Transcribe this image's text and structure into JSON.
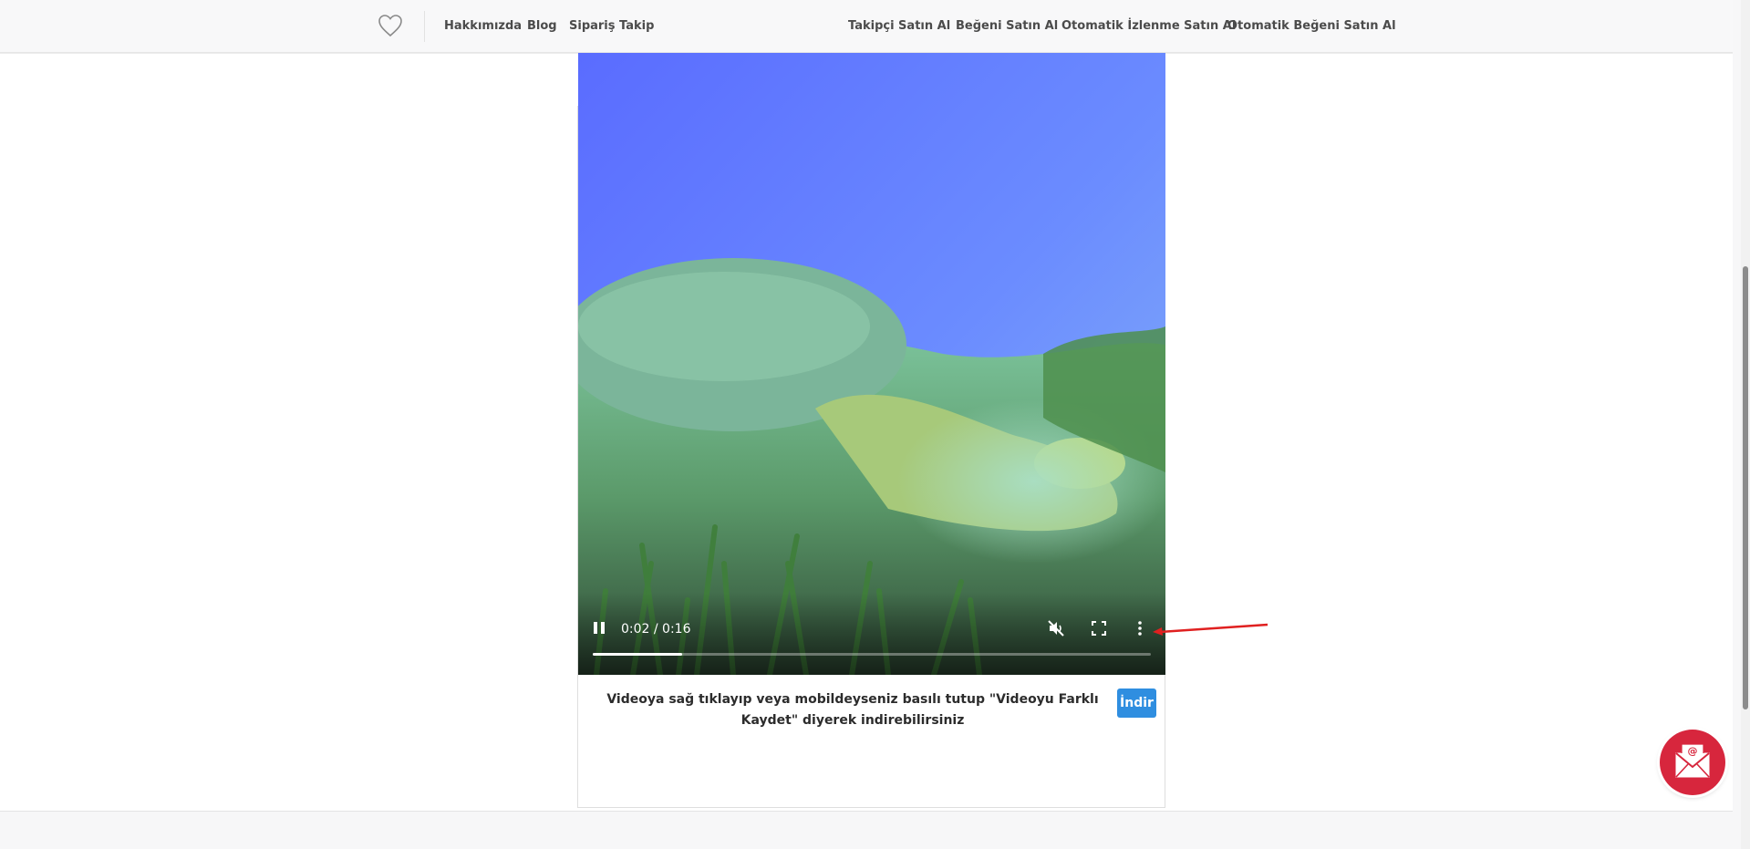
{
  "nav": {
    "logo_icon": "heart-outline-icon",
    "left_links": [
      "Hakkımızda",
      "Blog",
      "Sipariş Takip"
    ],
    "right_links": [
      "Takipçi Satın Al",
      "Beğeni Satın Al",
      "Otomatik İzlenme Satın Al",
      "Otomatik Beğeni Satın Al"
    ]
  },
  "video": {
    "time_display": "0:02 / 0:16",
    "progress_fraction": 0.16,
    "state": "playing",
    "muted": true,
    "icons": {
      "play_pause": "pause-icon",
      "mute": "volume-muted-icon",
      "fullscreen": "fullscreen-icon",
      "more": "more-options-icon"
    }
  },
  "caption": "Videoya sağ tıklayıp veya mobildeyseniz basılı tutup \"Videoyu Farklı Kaydet\" diyerek indirebilirsiniz",
  "download_button": "İndir",
  "annotation": {
    "type": "red-arrow",
    "color": "#e02020",
    "points_to": "more-options-icon"
  },
  "floating_button": {
    "icon": "mail-envelope-icon",
    "color": "#d7263d"
  }
}
